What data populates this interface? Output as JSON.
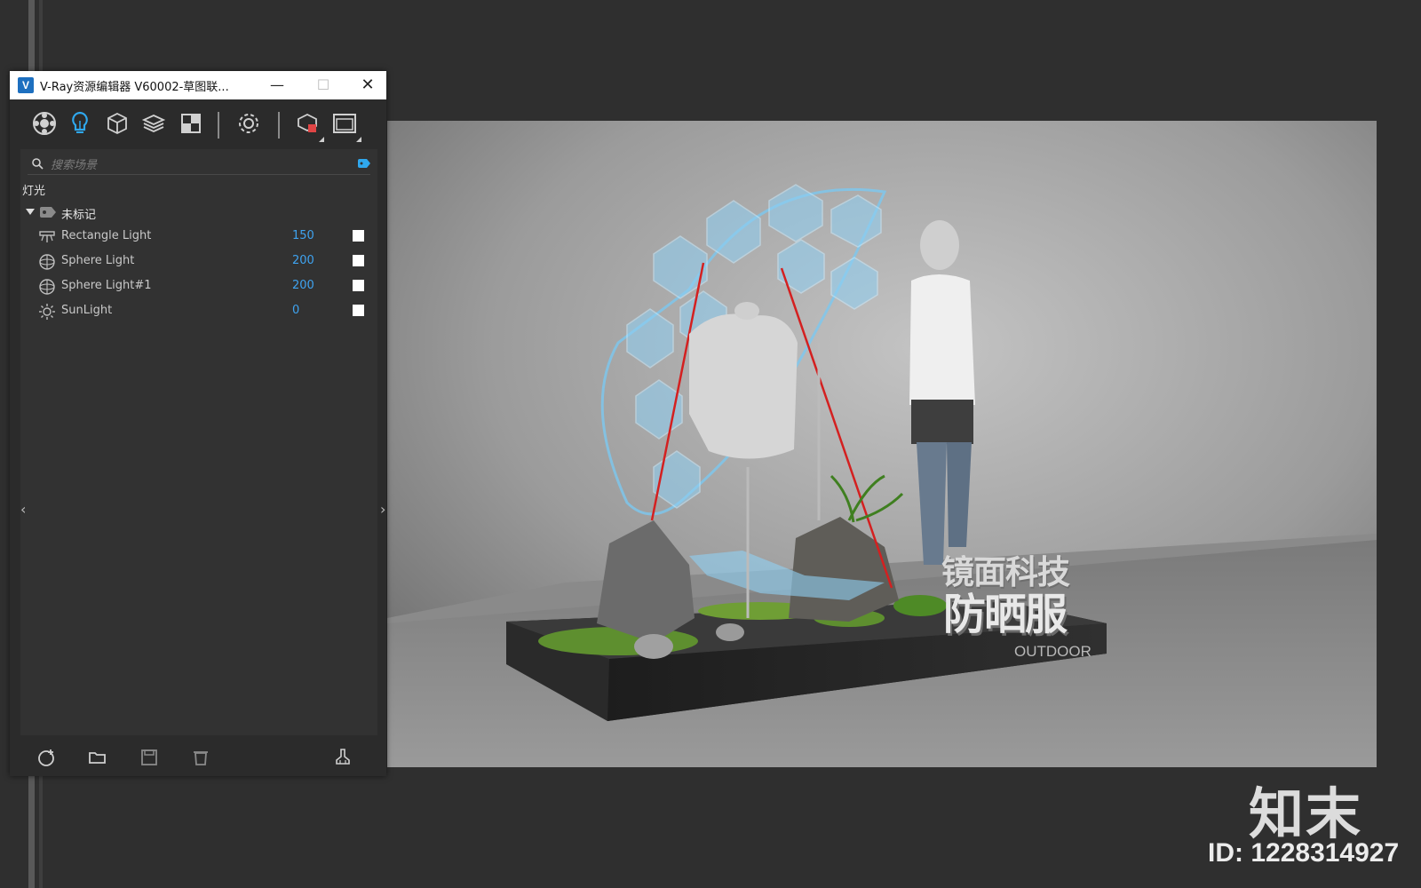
{
  "window": {
    "title": "V-Ray资源编辑器 V60002-草图联...",
    "app_icon": "V",
    "buttons": {
      "minimize": "—",
      "maximize": "☐",
      "close": "✕"
    }
  },
  "toolbar": {
    "icons": [
      "materials-icon",
      "lights-icon",
      "geometry-icon",
      "layers-icon",
      "textures-icon",
      "settings-icon",
      "render-icon",
      "frame-buffer-icon"
    ],
    "active": "lights-icon",
    "accent": "#2fa8ee"
  },
  "search": {
    "placeholder": "搜索场景"
  },
  "section_title": "灯光",
  "group": {
    "label": "未标记"
  },
  "lights": [
    {
      "name": "Rectangle Light",
      "value": "150",
      "icon": "rectangle-light-icon",
      "enabled": true
    },
    {
      "name": "Sphere Light",
      "value": "200",
      "icon": "sphere-light-icon",
      "enabled": true
    },
    {
      "name": "Sphere Light#1",
      "value": "200",
      "icon": "sphere-light-icon",
      "enabled": true
    },
    {
      "name": "SunLight",
      "value": "0",
      "icon": "sun-light-icon",
      "enabled": true
    }
  ],
  "nav": {
    "left": "‹",
    "right": "›"
  },
  "bottombar": {
    "icons": [
      "add-icon",
      "open-folder-icon",
      "save-icon",
      "delete-icon",
      "purge-icon"
    ]
  },
  "viewport": {
    "title_line1": "镜面科技",
    "title_line2": "防晒服",
    "subtitle": "OUTDOOR"
  },
  "watermark": {
    "name": "知末",
    "id": "ID: 1228314927"
  },
  "colors": {
    "value_blue": "#3fa3f0",
    "rope_red": "#d42020",
    "glass_blue": "#7cc8f0"
  }
}
